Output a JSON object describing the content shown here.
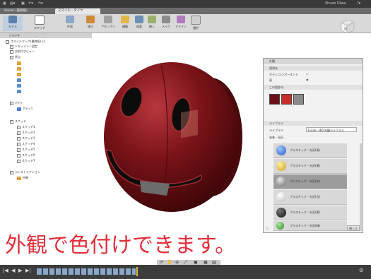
{
  "titlebar": {
    "user": "Shuzo Oiwa"
  },
  "tabs": [
    {
      "label": "Smile! (最終版)"
    },
    {
      "label": "スマイル - タイヤ"
    }
  ],
  "toolbar": {
    "mode": "モデル",
    "groups": [
      "スケッチ",
      "作成",
      "修正",
      "アセンブリ",
      "構築",
      "検査",
      "挿入",
      "メイク",
      "アドイン",
      "選択"
    ]
  },
  "browser": {
    "header": "ブラウザ",
    "items": [
      "スマイルマーク(最終版) v1",
      "ドキュメント設定",
      "名前付きビュー",
      "原点",
      "ボディ",
      "スケッチ",
      "コンストラクション",
      "外観",
      "ボディ1",
      "スケッチ1",
      "スケッチ2",
      "スケッチ3",
      "スケッチ4",
      "スケッチ5",
      "スケッチ6",
      "スケッチ7"
    ]
  },
  "viewcube": {
    "face": "前"
  },
  "appearance_panel": {
    "title": "外観",
    "apply_to_label": "適用先",
    "option1": "ボディ/コンポーネント",
    "option2": "面",
    "in_design": "この設計内",
    "library_section": "ライブラリ",
    "library_label": "ライブラリ",
    "library_value": "Fusion 360 外観ライブラリ",
    "category": "塗装 - 光沢",
    "items": [
      "プラスチック - 光沢(青)",
      "プラスチック - 光沢(黄)",
      "プラスチック - 光沢(灰)",
      "プラスチック - 光沢(白)",
      "プラスチック - 光沢(黒)",
      "プラスチック - 光沢(緑)"
    ],
    "close_button": "閉じる"
  },
  "caption": "外観で色付けできます。",
  "colors": {
    "body": "#6b1014",
    "caption": "#e0303a"
  }
}
